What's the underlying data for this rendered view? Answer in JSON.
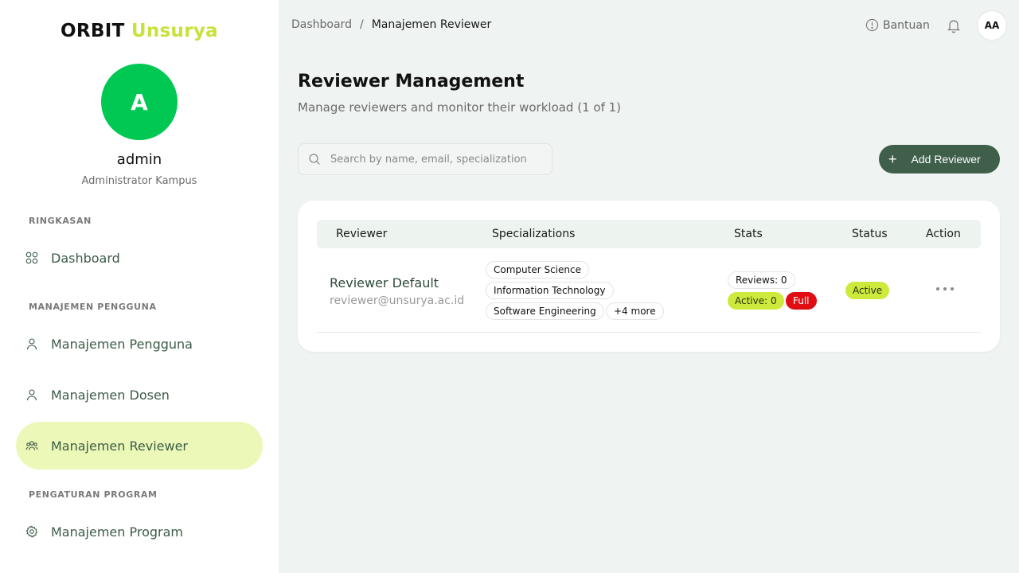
{
  "sidebar": {
    "brand_primary": "ORBIT",
    "brand_secondary": "Unsurya",
    "avatar_initial": "A",
    "user_name": "admin",
    "user_role": "Administrator Kampus",
    "sections": {
      "summary": "RINGKASAN",
      "user_management": "MANAJEMEN PENGGUNA",
      "program_settings": "PENGATURAN PROGRAM"
    },
    "items": [
      {
        "label": "Dashboard",
        "icon": "grid-icon"
      },
      {
        "label": "Manajemen Pengguna",
        "icon": "user-icon"
      },
      {
        "label": "Manajemen Dosen",
        "icon": "user-icon"
      },
      {
        "label": "Manajemen Reviewer",
        "icon": "users-group-icon",
        "active": true
      },
      {
        "label": "Manajemen Program",
        "icon": "settings-icon"
      }
    ]
  },
  "topbar": {
    "breadcrumb_root": "Dashboard",
    "breadcrumb_sep": "/",
    "breadcrumb_current": "Manajemen Reviewer",
    "help_label": "Bantuan",
    "avatar_initials": "AA"
  },
  "main": {
    "title": "Reviewer Management",
    "subtitle": "Manage reviewers and monitor their workload (1 of 1)",
    "search_placeholder": "Search by name, email, specialization",
    "add_button_label": "Add Reviewer",
    "table": {
      "headers": [
        "Reviewer",
        "Specializations",
        "Stats",
        "Status",
        "Action"
      ],
      "rows": [
        {
          "name": "Reviewer Default",
          "email": "reviewer@unsurya.ac.id",
          "specializations": [
            "Computer Science",
            "Information Technology",
            "Software Engineering"
          ],
          "more_label": "+4 more",
          "reviews": "Reviews: 0",
          "active": "Active: 0",
          "capacity": "Full",
          "status": "Active"
        }
      ]
    }
  },
  "colors": {
    "accent_lime": "#cdea3c",
    "brand_green": "#00c853",
    "primary_dark_green": "#3f5f4b",
    "danger_red": "#e00d12"
  }
}
